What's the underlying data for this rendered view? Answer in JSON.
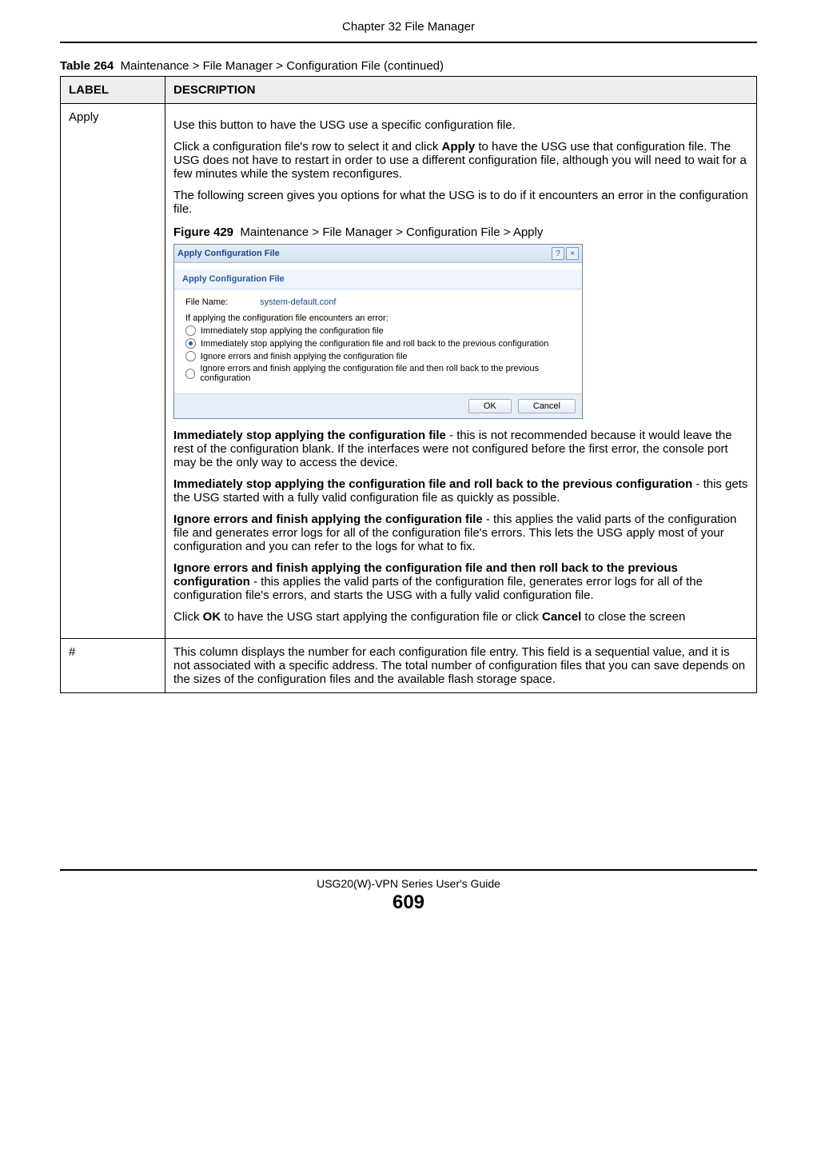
{
  "chapter_title": "Chapter 32 File Manager",
  "table_caption_prefix": "Table 264",
  "table_caption_text": "Maintenance > File Manager > Configuration File (continued)",
  "headers": {
    "label": "LABEL",
    "description": "DESCRIPTION"
  },
  "rows": {
    "apply": {
      "label": "Apply",
      "p1": "Use this button to have the USG use a specific configuration file.",
      "p2_a": "Click a configuration file's row to select it and click ",
      "p2_b": "Apply",
      "p2_c": " to have the USG use that configuration file. The USG does not have to restart in order to use a different configuration file, although you will need to wait for a few minutes while the system reconfigures.",
      "p3": "The following screen gives you options for what the USG is to do if it encounters an error in the configuration file.",
      "figure_prefix": "Figure 429",
      "figure_text": "Maintenance > File Manager > Configuration File > Apply",
      "opt1_b": "Immediately stop applying the configuration file",
      "opt1_t": " - this is not recommended because it would leave the rest of the configuration blank. If the interfaces were not configured before the first error, the console port may be the only way to access the device.",
      "opt2_b": "Immediately stop applying the configuration file and roll back to the previous configuration",
      "opt2_t": " - this gets the USG started with a fully valid configuration file as quickly as possible.",
      "opt3_b": "Ignore errors and finish applying the configuration file",
      "opt3_t": " - this applies the valid parts of the configuration file and generates error logs for all of the configuration file's errors. This lets the USG apply most of your configuration and you can refer to the logs for what to fix.",
      "opt4_b": "Ignore errors and finish applying the configuration file and then roll back to the previous configuration",
      "opt4_t": " - this applies the valid parts of the configuration file, generates error logs for all of the configuration file's errors, and starts the USG with a fully valid configuration file.",
      "p_last_a": "Click ",
      "p_last_b": "OK",
      "p_last_c": " to have the USG start applying the configuration file or click ",
      "p_last_d": "Cancel",
      "p_last_e": " to close the screen"
    },
    "hash": {
      "label": "#",
      "text": "This column displays the number for each configuration file entry. This field is a sequential value, and it is not associated with a specific address. The total number of configuration files that you can save depends on the sizes of the configuration files and the available flash storage space."
    }
  },
  "screenshot": {
    "window_title": "Apply Configuration File",
    "section_title": "Apply Configuration File",
    "file_name_label": "File Name:",
    "file_name_value": "system-default.conf",
    "error_prompt": "If applying the configuration file encounters an error:",
    "radio1": "Immediately stop applying the configuration file",
    "radio2": "Immediately stop applying the configuration file and roll back to the previous configuration",
    "radio3": "Ignore errors and finish applying the configuration file",
    "radio4": "Ignore errors and finish applying the configuration file and then roll back to the previous configuration",
    "ok": "OK",
    "cancel": "Cancel",
    "help_icon": "?",
    "close_icon": "×"
  },
  "footer": {
    "guide": "USG20(W)-VPN Series User's Guide",
    "page": "609"
  }
}
